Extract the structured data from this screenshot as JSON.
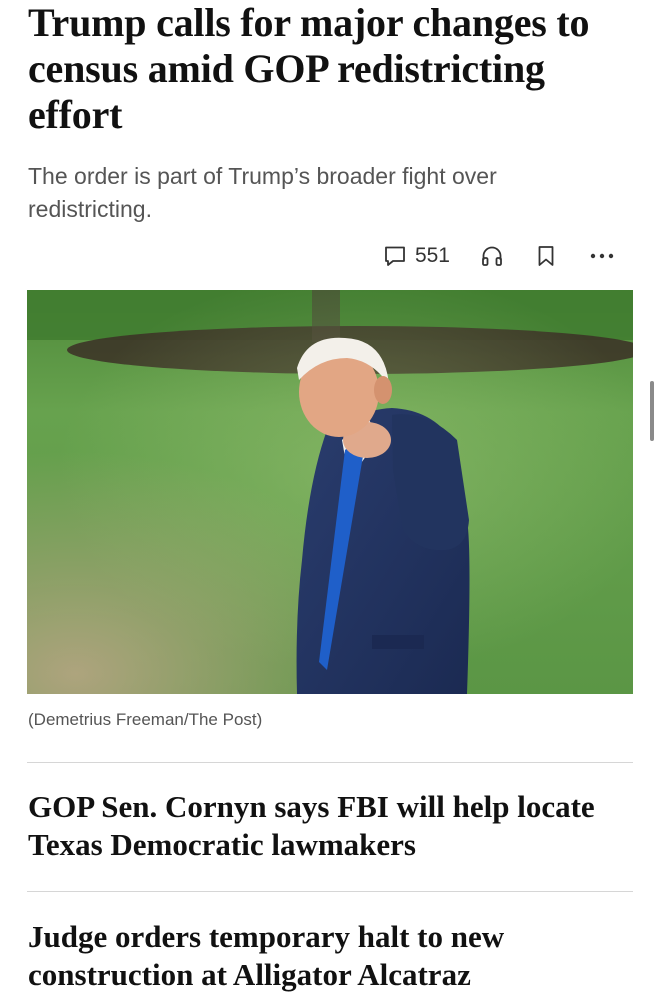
{
  "article": {
    "headline": "Trump calls for major changes to census amid GOP redistricting effort",
    "dek": "The order is part of Trump’s broader fight over redistricting.",
    "comment_count": "551",
    "photo_caption": "(Demetrius Freeman/The Post)"
  },
  "actions": {
    "icons": [
      "comment-icon",
      "headphones-icon",
      "bookmark-icon",
      "more-icon"
    ]
  },
  "related": [
    {
      "headline": "GOP Sen. Cornyn says FBI will help locate Texas Democratic lawmakers"
    },
    {
      "headline": "Judge orders temporary halt to new construction at Alligator Alcatraz"
    }
  ],
  "colors": {
    "headline_text": "#111111",
    "dek_text": "#555555",
    "divider": "#d6d6d6",
    "photo_grass": "#5f9a4c"
  }
}
